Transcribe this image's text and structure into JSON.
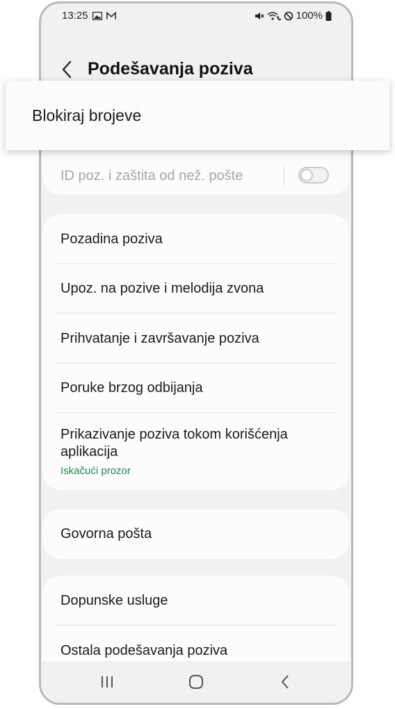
{
  "status_bar": {
    "time": "13:25",
    "battery": "100%",
    "icons_left": [
      "image-icon",
      "gmail-icon"
    ],
    "icons_right": [
      "mute-icon",
      "wifi-calling-icon",
      "do-not-disturb-icon",
      "battery-icon"
    ]
  },
  "header": {
    "title": "Podešavanja poziva"
  },
  "popup": {
    "label": "Blokiraj brojeve"
  },
  "caller_id_card": {
    "label": "ID poz. i zaštita od než. pošte",
    "toggle_on": false
  },
  "settings_group_1": {
    "items": [
      {
        "label": "Pozadina poziva"
      },
      {
        "label": "Upoz. na pozive i melodija zvona"
      },
      {
        "label": "Prihvatanje i završavanje poziva"
      },
      {
        "label": "Poruke brzog odbijanja"
      },
      {
        "label": "Prikazivanje poziva tokom korišćenja aplikacija",
        "sub": "Iskačući prozor"
      }
    ]
  },
  "settings_group_2": {
    "items": [
      {
        "label": "Govorna pošta"
      }
    ]
  },
  "settings_group_3": {
    "items": [
      {
        "label": "Dopunske usluge"
      },
      {
        "label": "Ostala podešavanja poziva"
      }
    ]
  },
  "colors": {
    "accent_green": "#1b8a4a",
    "background": "#f1f1f1",
    "card": "#fcfcfc"
  }
}
